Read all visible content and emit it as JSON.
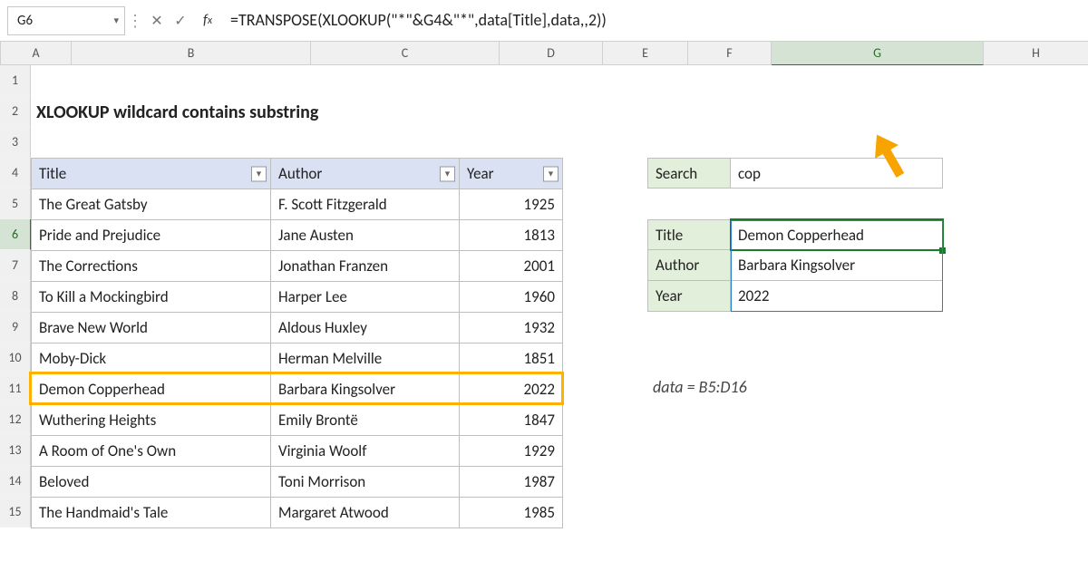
{
  "nameBox": "G6",
  "formula": "=TRANSPOSE(XLOOKUP(\"*\"&G4&\"*\",data[Title],data,,2))",
  "columns": [
    "A",
    "B",
    "C",
    "D",
    "E",
    "F",
    "G",
    "H"
  ],
  "rows": [
    "1",
    "2",
    "3",
    "4",
    "5",
    "6",
    "7",
    "8",
    "9",
    "10",
    "11",
    "12",
    "13",
    "14",
    "15"
  ],
  "caption": "XLOOKUP wildcard contains substring",
  "headers": {
    "title": "Title",
    "author": "Author",
    "year": "Year"
  },
  "books": [
    {
      "title": "The Great Gatsby",
      "author": "F. Scott Fitzgerald",
      "year": "1925"
    },
    {
      "title": "Pride and Prejudice",
      "author": "Jane Austen",
      "year": "1813"
    },
    {
      "title": "The Corrections",
      "author": "Jonathan Franzen",
      "year": "2001"
    },
    {
      "title": "To Kill a Mockingbird",
      "author": "Harper Lee",
      "year": "1960"
    },
    {
      "title": "Brave New World",
      "author": "Aldous Huxley",
      "year": "1932"
    },
    {
      "title": "Moby-Dick",
      "author": "Herman Melville",
      "year": "1851"
    },
    {
      "title": "Demon Copperhead",
      "author": "Barbara Kingsolver",
      "year": "2022"
    },
    {
      "title": "Wuthering Heights",
      "author": "Emily Brontë",
      "year": "1847"
    },
    {
      "title": "A Room of One's Own",
      "author": "Virginia Woolf",
      "year": "1929"
    },
    {
      "title": "Beloved",
      "author": "Toni Morrison",
      "year": "1987"
    },
    {
      "title": "The Handmaid's Tale",
      "author": "Margaret Atwood",
      "year": "1985"
    }
  ],
  "search": {
    "label": "Search",
    "value": "cop"
  },
  "result": {
    "labels": {
      "title": "Title",
      "author": "Author",
      "year": "Year"
    },
    "values": {
      "title": "Demon Copperhead",
      "author": "Barbara Kingsolver",
      "year": "2022"
    }
  },
  "dataNote": "data = B5:D16",
  "activeCol": "G",
  "activeRow": "6",
  "highlightRowIndex": 6
}
